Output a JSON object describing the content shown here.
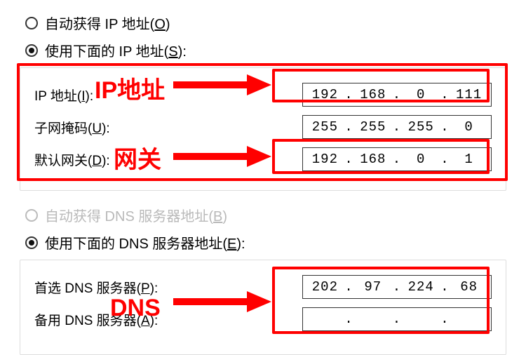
{
  "ip_section": {
    "auto_label_pre": "自动获得 IP 地址(",
    "auto_hotkey": "O",
    "auto_label_post": ")",
    "manual_label_pre": "使用下面的 IP 地址(",
    "manual_hotkey": "S",
    "manual_label_post": "):",
    "fields": {
      "ip": {
        "label_pre": "IP 地址(",
        "hotkey": "I",
        "label_post": "):",
        "o1": "192",
        "o2": "168",
        "o3": "0",
        "o4": "111"
      },
      "mask": {
        "label_pre": "子网掩码(",
        "hotkey": "U",
        "label_post": "):",
        "o1": "255",
        "o2": "255",
        "o3": "255",
        "o4": "0"
      },
      "gw": {
        "label_pre": "默认网关(",
        "hotkey": "D",
        "label_post": "):",
        "o1": "192",
        "o2": "168",
        "o3": "0",
        "o4": "1"
      }
    }
  },
  "dns_section": {
    "auto_label_pre": "自动获得 DNS 服务器地址(",
    "auto_hotkey": "B",
    "auto_label_post": ")",
    "manual_label_pre": "使用下面的 DNS 服务器地址(",
    "manual_hotkey": "E",
    "manual_label_post": "):",
    "fields": {
      "pref": {
        "label_pre": "首选 DNS 服务器(",
        "hotkey": "P",
        "label_post": "):",
        "o1": "202",
        "o2": "97",
        "o3": "224",
        "o4": "68"
      },
      "alt": {
        "label_pre": "备用 DNS 服务器(",
        "hotkey": "A",
        "label_post": "):",
        "o1": "",
        "o2": "",
        "o3": "",
        "o4": ""
      }
    }
  },
  "annotations": {
    "ip_text": "IP地址",
    "gw_text": "网关",
    "dns_text": "DNS"
  }
}
